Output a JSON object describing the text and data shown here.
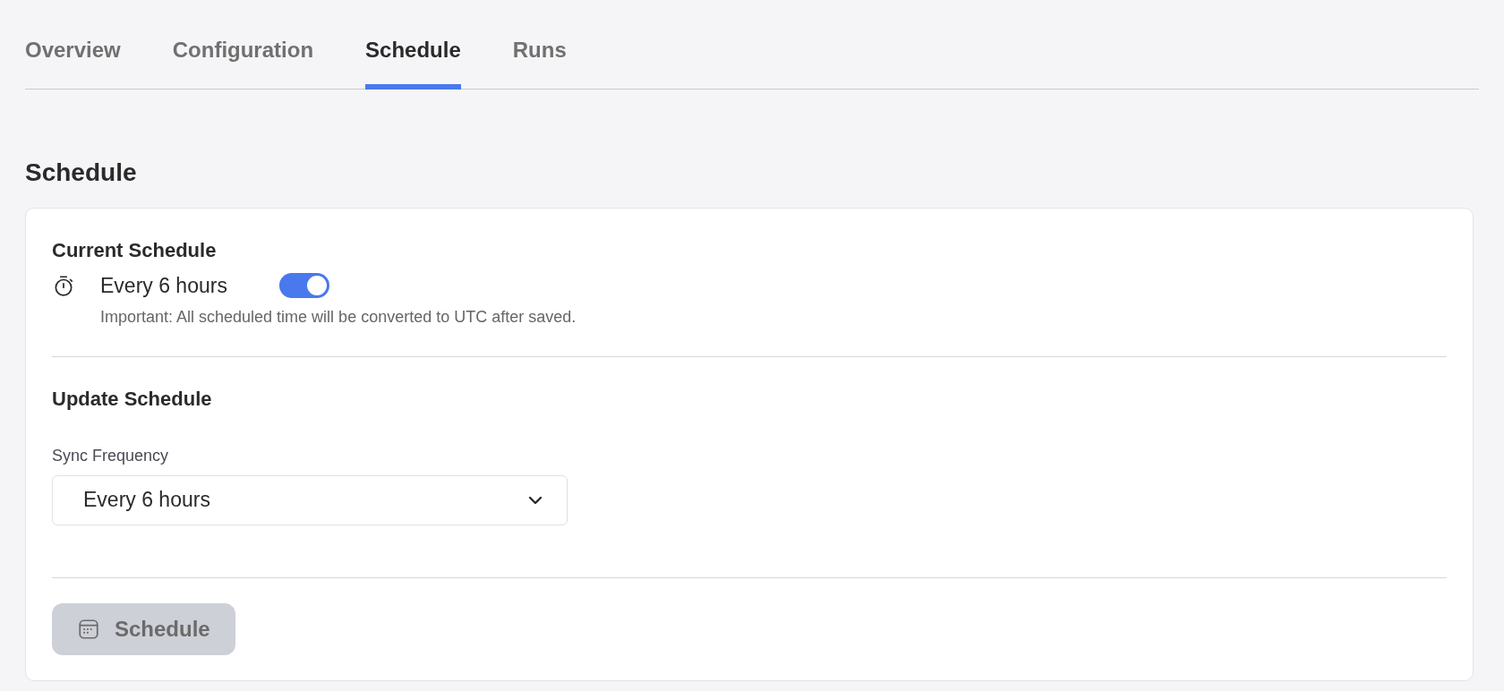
{
  "tabs": [
    {
      "label": "Overview",
      "selected": false
    },
    {
      "label": "Configuration",
      "selected": false
    },
    {
      "label": "Schedule",
      "selected": true
    },
    {
      "label": "Runs",
      "selected": false
    }
  ],
  "section_title": "Schedule",
  "current_schedule": {
    "title": "Current Schedule",
    "value": "Every 6 hours",
    "enabled": true,
    "note": "Important: All scheduled time will be converted to UTC after saved."
  },
  "update_schedule": {
    "title": "Update Schedule",
    "field_label": "Sync Frequency",
    "value": "Every 6 hours"
  },
  "schedule_button": {
    "label": "Schedule",
    "disabled": true
  }
}
